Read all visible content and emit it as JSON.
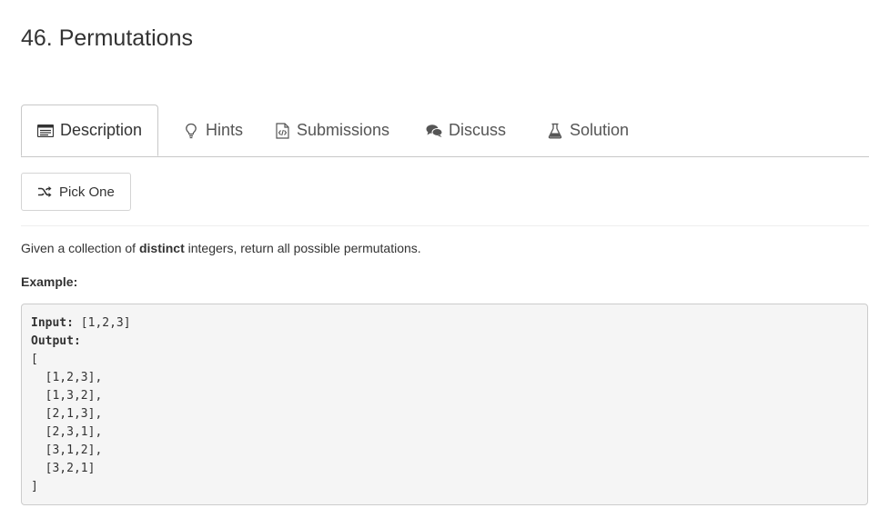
{
  "problem": {
    "title": "46. Permutations"
  },
  "tabs": [
    {
      "label": "Description",
      "icon": "description-icon",
      "active": true
    },
    {
      "label": "Hints",
      "icon": "lightbulb-icon",
      "active": false
    },
    {
      "label": "Submissions",
      "icon": "code-file-icon",
      "active": false
    },
    {
      "label": "Discuss",
      "icon": "comments-icon",
      "active": false
    },
    {
      "label": "Solution",
      "icon": "flask-icon",
      "active": false
    }
  ],
  "pick_one": {
    "label": "Pick One",
    "icon": "shuffle-icon"
  },
  "description": {
    "prefix": "Given a collection of ",
    "bold": "distinct",
    "suffix": " integers, return all possible permutations."
  },
  "example": {
    "label": "Example:",
    "input_label": "Input:",
    "input_value": " [1,2,3]",
    "output_label": "Output:",
    "output_lines": [
      "[",
      "  [1,2,3],",
      "  [1,3,2],",
      "  [2,1,3],",
      "  [2,3,1],",
      "  [3,1,2],",
      "  [3,2,1]",
      "]"
    ]
  }
}
